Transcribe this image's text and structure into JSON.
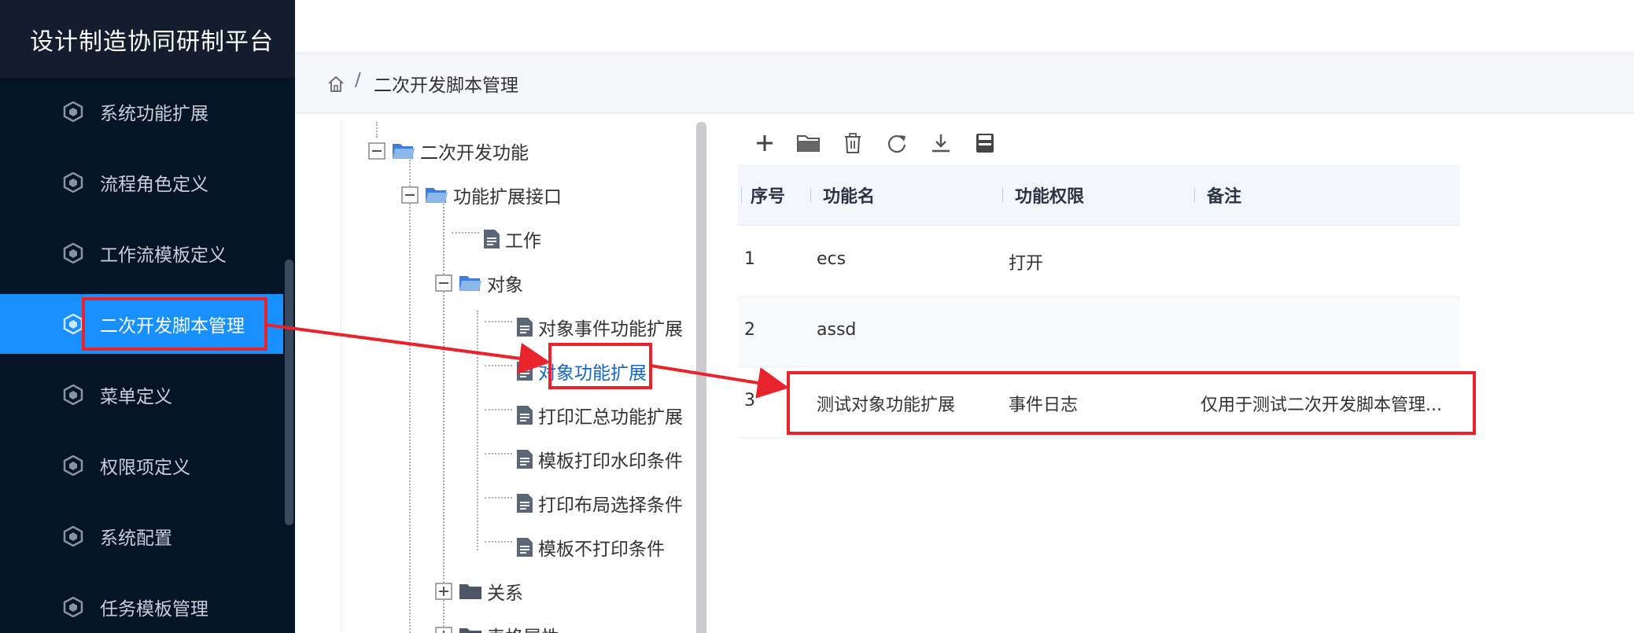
{
  "app": {
    "title": "设计制造协同研制平台"
  },
  "sidebar": {
    "items": [
      {
        "label": "系统功能扩展"
      },
      {
        "label": "流程角色定义"
      },
      {
        "label": "工作流模板定义"
      },
      {
        "label": "二次开发脚本管理",
        "active": true
      },
      {
        "label": "菜单定义"
      },
      {
        "label": "权限项定义"
      },
      {
        "label": "系统配置"
      },
      {
        "label": "任务模板管理"
      }
    ]
  },
  "breadcrumb": {
    "separator": "/",
    "current": "二次开发脚本管理"
  },
  "tree": {
    "nodes": [
      {
        "label": "二次开发功能"
      },
      {
        "label": "功能扩展接口"
      },
      {
        "label": "工作"
      },
      {
        "label": "对象"
      },
      {
        "label": "对象事件功能扩展"
      },
      {
        "label": "对象功能扩展",
        "selected": true
      },
      {
        "label": "打印汇总功能扩展"
      },
      {
        "label": "模板打印水印条件"
      },
      {
        "label": "打印布局选择条件"
      },
      {
        "label": "模板不打印条件"
      },
      {
        "label": "关系"
      },
      {
        "label": "表格属性"
      }
    ]
  },
  "toolbar": {
    "buttons": [
      {
        "icon": "plus-icon"
      },
      {
        "icon": "folder-icon"
      },
      {
        "icon": "trash-icon"
      },
      {
        "icon": "refresh-icon"
      },
      {
        "icon": "download-icon"
      },
      {
        "icon": "save-icon"
      }
    ]
  },
  "table": {
    "headers": [
      "序号",
      "功能名",
      "功能权限",
      "备注"
    ],
    "rows": [
      [
        "1",
        "ecs",
        "打开",
        ""
      ],
      [
        "2",
        "assd",
        "",
        ""
      ],
      [
        "3",
        "测试对象功能扩展",
        "事件日志",
        "仅用于测试二次开发脚本管理..."
      ]
    ]
  },
  "colors": {
    "sidebar_bg": "#061428",
    "active": "#1890ff",
    "annotation": "#e8232b"
  }
}
